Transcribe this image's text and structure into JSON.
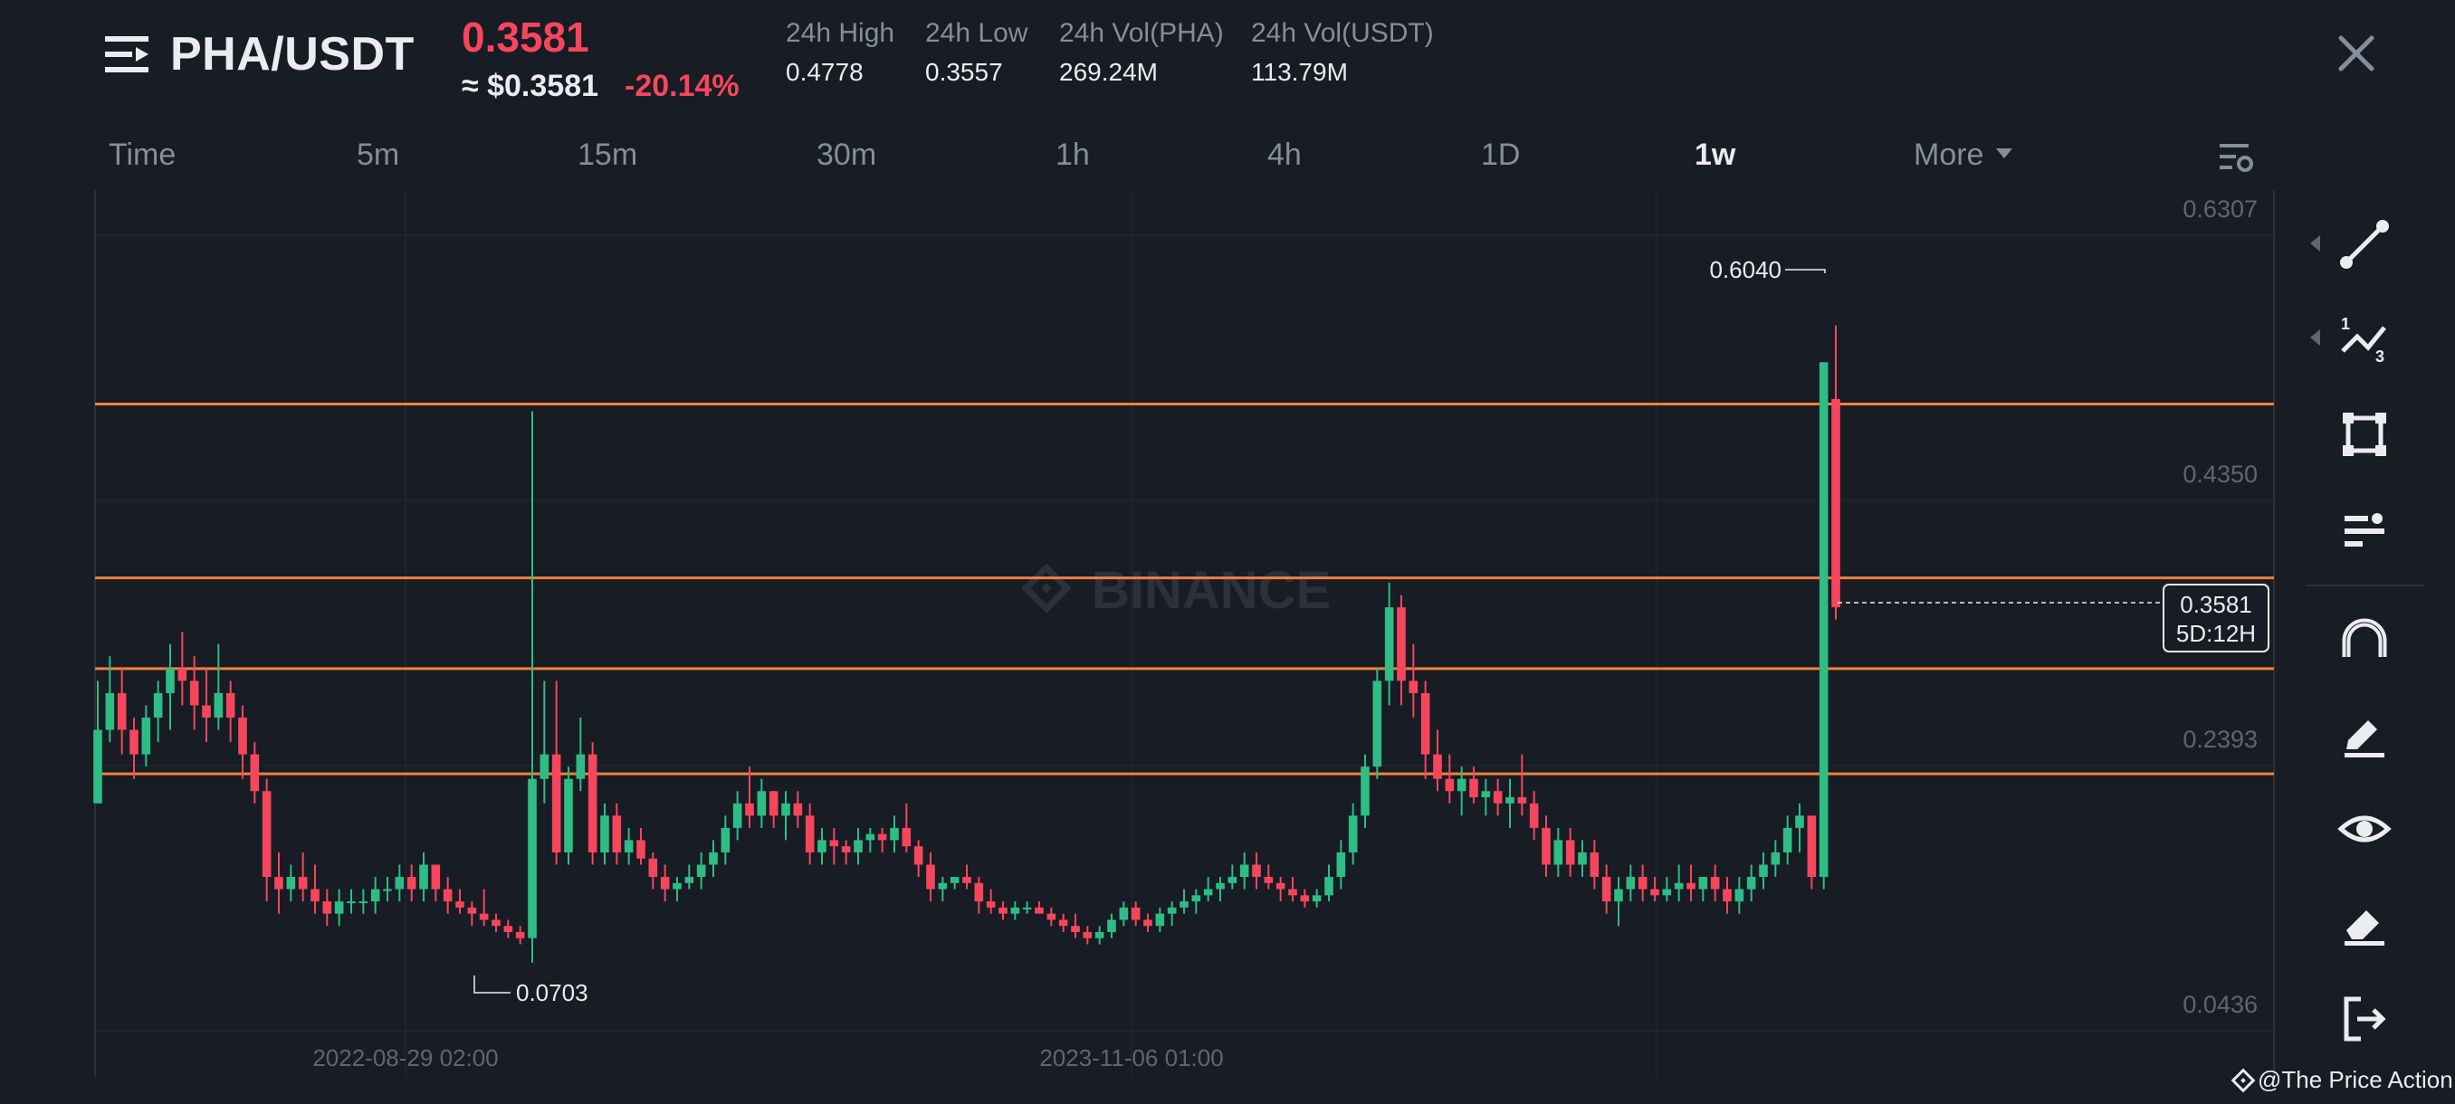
{
  "header": {
    "pair": "PHA/USDT",
    "last_price": "0.3581",
    "usd_price": "≈ $0.3581",
    "change": "-20.14%",
    "stats": [
      {
        "label": "24h High",
        "value": "0.4778"
      },
      {
        "label": "24h Low",
        "value": "0.3557"
      },
      {
        "label": "24h Vol(PHA)",
        "value": "269.24M"
      },
      {
        "label": "24h Vol(USDT)",
        "value": "113.79M"
      }
    ]
  },
  "intervals": [
    {
      "label": "Time",
      "active": false
    },
    {
      "label": "5m",
      "active": false
    },
    {
      "label": "15m",
      "active": false
    },
    {
      "label": "30m",
      "active": false
    },
    {
      "label": "1h",
      "active": false
    },
    {
      "label": "4h",
      "active": false
    },
    {
      "label": "1D",
      "active": false
    },
    {
      "label": "1w",
      "active": true
    },
    {
      "label": "More",
      "active": false
    }
  ],
  "chart_data": {
    "type": "candlestick",
    "interval": "1w",
    "y_axis_labels": [
      "0.6307",
      "0.4350",
      "0.2393",
      "0.0436"
    ],
    "ylim": [
      0.0145,
      0.6636
    ],
    "x_axis_labels": [
      "2022-08-29 02:00",
      "2023-11-06 01:00"
    ],
    "watermark": "BINANCE",
    "high_marker": "0.6040",
    "low_marker": "0.0703",
    "current_price": "0.3581",
    "countdown": "5D:12H",
    "horizontal_levels": [
      0.5259,
      0.384,
      0.31,
      0.2241
    ],
    "level_color": "#f0803c",
    "up_color": "#2ebd85",
    "down_color": "#f6465d",
    "candles": [
      [
        0.2,
        0.3,
        0.23,
        0.26
      ],
      [
        0.26,
        0.32,
        0.25,
        0.29
      ],
      [
        0.29,
        0.31,
        0.24,
        0.26
      ],
      [
        0.26,
        0.27,
        0.22,
        0.24
      ],
      [
        0.24,
        0.28,
        0.23,
        0.27
      ],
      [
        0.27,
        0.3,
        0.25,
        0.29
      ],
      [
        0.29,
        0.33,
        0.26,
        0.31
      ],
      [
        0.31,
        0.34,
        0.28,
        0.3
      ],
      [
        0.3,
        0.32,
        0.26,
        0.28
      ],
      [
        0.28,
        0.31,
        0.25,
        0.27
      ],
      [
        0.27,
        0.33,
        0.26,
        0.29
      ],
      [
        0.29,
        0.3,
        0.25,
        0.27
      ],
      [
        0.27,
        0.28,
        0.22,
        0.24
      ],
      [
        0.24,
        0.25,
        0.2,
        0.21
      ],
      [
        0.21,
        0.22,
        0.12,
        0.14
      ],
      [
        0.14,
        0.16,
        0.11,
        0.13
      ],
      [
        0.13,
        0.15,
        0.12,
        0.14
      ],
      [
        0.14,
        0.16,
        0.12,
        0.13
      ],
      [
        0.13,
        0.15,
        0.11,
        0.12
      ],
      [
        0.12,
        0.13,
        0.1,
        0.11
      ],
      [
        0.11,
        0.13,
        0.1,
        0.12
      ],
      [
        0.12,
        0.13,
        0.11,
        0.12
      ],
      [
        0.12,
        0.13,
        0.11,
        0.12
      ],
      [
        0.12,
        0.14,
        0.11,
        0.13
      ],
      [
        0.13,
        0.14,
        0.12,
        0.13
      ],
      [
        0.13,
        0.15,
        0.12,
        0.14
      ],
      [
        0.14,
        0.15,
        0.12,
        0.13
      ],
      [
        0.13,
        0.16,
        0.12,
        0.15
      ],
      [
        0.15,
        0.15,
        0.12,
        0.13
      ],
      [
        0.13,
        0.14,
        0.11,
        0.12
      ],
      [
        0.12,
        0.13,
        0.11,
        0.115
      ],
      [
        0.115,
        0.12,
        0.1,
        0.11
      ],
      [
        0.11,
        0.13,
        0.1,
        0.105
      ],
      [
        0.105,
        0.11,
        0.095,
        0.1
      ],
      [
        0.1,
        0.105,
        0.09,
        0.095
      ],
      [
        0.095,
        0.1,
        0.085,
        0.09
      ],
      [
        0.09,
        0.52,
        0.07,
        0.22
      ],
      [
        0.22,
        0.3,
        0.2,
        0.24
      ],
      [
        0.24,
        0.3,
        0.15,
        0.16
      ],
      [
        0.16,
        0.23,
        0.15,
        0.22
      ],
      [
        0.22,
        0.27,
        0.21,
        0.24
      ],
      [
        0.24,
        0.25,
        0.15,
        0.16
      ],
      [
        0.16,
        0.2,
        0.15,
        0.19
      ],
      [
        0.19,
        0.2,
        0.15,
        0.16
      ],
      [
        0.16,
        0.18,
        0.15,
        0.17
      ],
      [
        0.17,
        0.18,
        0.15,
        0.155
      ],
      [
        0.155,
        0.16,
        0.13,
        0.14
      ],
      [
        0.14,
        0.15,
        0.12,
        0.13
      ],
      [
        0.13,
        0.14,
        0.12,
        0.135
      ],
      [
        0.135,
        0.15,
        0.13,
        0.14
      ],
      [
        0.14,
        0.16,
        0.13,
        0.15
      ],
      [
        0.15,
        0.17,
        0.14,
        0.16
      ],
      [
        0.16,
        0.19,
        0.15,
        0.18
      ],
      [
        0.18,
        0.21,
        0.17,
        0.2
      ],
      [
        0.2,
        0.23,
        0.18,
        0.19
      ],
      [
        0.19,
        0.22,
        0.18,
        0.21
      ],
      [
        0.21,
        0.21,
        0.18,
        0.19
      ],
      [
        0.19,
        0.21,
        0.17,
        0.2
      ],
      [
        0.2,
        0.21,
        0.18,
        0.19
      ],
      [
        0.19,
        0.2,
        0.15,
        0.16
      ],
      [
        0.16,
        0.18,
        0.15,
        0.17
      ],
      [
        0.17,
        0.18,
        0.15,
        0.165
      ],
      [
        0.165,
        0.17,
        0.15,
        0.16
      ],
      [
        0.16,
        0.18,
        0.15,
        0.17
      ],
      [
        0.17,
        0.18,
        0.16,
        0.175
      ],
      [
        0.175,
        0.18,
        0.16,
        0.17
      ],
      [
        0.17,
        0.19,
        0.16,
        0.18
      ],
      [
        0.18,
        0.2,
        0.16,
        0.165
      ],
      [
        0.165,
        0.17,
        0.14,
        0.15
      ],
      [
        0.15,
        0.16,
        0.12,
        0.13
      ],
      [
        0.13,
        0.14,
        0.12,
        0.135
      ],
      [
        0.135,
        0.14,
        0.13,
        0.14
      ],
      [
        0.14,
        0.15,
        0.13,
        0.135
      ],
      [
        0.135,
        0.14,
        0.11,
        0.12
      ],
      [
        0.12,
        0.13,
        0.11,
        0.115
      ],
      [
        0.115,
        0.12,
        0.105,
        0.11
      ],
      [
        0.11,
        0.12,
        0.105,
        0.115
      ],
      [
        0.115,
        0.12,
        0.11,
        0.115
      ],
      [
        0.115,
        0.12,
        0.11,
        0.11
      ],
      [
        0.11,
        0.115,
        0.1,
        0.105
      ],
      [
        0.105,
        0.11,
        0.095,
        0.1
      ],
      [
        0.1,
        0.11,
        0.09,
        0.095
      ],
      [
        0.095,
        0.1,
        0.085,
        0.09
      ],
      [
        0.09,
        0.1,
        0.085,
        0.095
      ],
      [
        0.095,
        0.11,
        0.09,
        0.105
      ],
      [
        0.105,
        0.12,
        0.1,
        0.115
      ],
      [
        0.115,
        0.12,
        0.1,
        0.105
      ],
      [
        0.105,
        0.11,
        0.095,
        0.1
      ],
      [
        0.1,
        0.115,
        0.095,
        0.11
      ],
      [
        0.11,
        0.12,
        0.1,
        0.115
      ],
      [
        0.115,
        0.13,
        0.11,
        0.12
      ],
      [
        0.12,
        0.13,
        0.11,
        0.125
      ],
      [
        0.125,
        0.14,
        0.12,
        0.13
      ],
      [
        0.13,
        0.14,
        0.12,
        0.135
      ],
      [
        0.135,
        0.15,
        0.13,
        0.14
      ],
      [
        0.14,
        0.16,
        0.13,
        0.15
      ],
      [
        0.15,
        0.16,
        0.13,
        0.14
      ],
      [
        0.14,
        0.15,
        0.13,
        0.135
      ],
      [
        0.135,
        0.14,
        0.12,
        0.13
      ],
      [
        0.13,
        0.14,
        0.12,
        0.125
      ],
      [
        0.125,
        0.13,
        0.115,
        0.12
      ],
      [
        0.12,
        0.13,
        0.115,
        0.125
      ],
      [
        0.125,
        0.15,
        0.12,
        0.14
      ],
      [
        0.14,
        0.17,
        0.13,
        0.16
      ],
      [
        0.16,
        0.2,
        0.15,
        0.19
      ],
      [
        0.19,
        0.24,
        0.18,
        0.23
      ],
      [
        0.23,
        0.31,
        0.22,
        0.3
      ],
      [
        0.3,
        0.38,
        0.28,
        0.36
      ],
      [
        0.36,
        0.37,
        0.28,
        0.3
      ],
      [
        0.3,
        0.33,
        0.27,
        0.29
      ],
      [
        0.29,
        0.3,
        0.22,
        0.24
      ],
      [
        0.24,
        0.26,
        0.21,
        0.22
      ],
      [
        0.22,
        0.24,
        0.2,
        0.21
      ],
      [
        0.21,
        0.23,
        0.19,
        0.22
      ],
      [
        0.22,
        0.23,
        0.2,
        0.205
      ],
      [
        0.205,
        0.22,
        0.19,
        0.21
      ],
      [
        0.21,
        0.22,
        0.19,
        0.2
      ],
      [
        0.2,
        0.22,
        0.18,
        0.205
      ],
      [
        0.205,
        0.24,
        0.19,
        0.2
      ],
      [
        0.2,
        0.21,
        0.17,
        0.18
      ],
      [
        0.18,
        0.19,
        0.14,
        0.15
      ],
      [
        0.15,
        0.18,
        0.14,
        0.17
      ],
      [
        0.17,
        0.18,
        0.14,
        0.15
      ],
      [
        0.15,
        0.17,
        0.14,
        0.16
      ],
      [
        0.16,
        0.17,
        0.13,
        0.14
      ],
      [
        0.14,
        0.15,
        0.11,
        0.12
      ],
      [
        0.12,
        0.14,
        0.1,
        0.13
      ],
      [
        0.13,
        0.15,
        0.12,
        0.14
      ],
      [
        0.14,
        0.15,
        0.12,
        0.13
      ],
      [
        0.13,
        0.14,
        0.12,
        0.125
      ],
      [
        0.125,
        0.14,
        0.12,
        0.13
      ],
      [
        0.13,
        0.15,
        0.12,
        0.135
      ],
      [
        0.135,
        0.15,
        0.12,
        0.13
      ],
      [
        0.13,
        0.14,
        0.12,
        0.14
      ],
      [
        0.14,
        0.15,
        0.12,
        0.13
      ],
      [
        0.13,
        0.14,
        0.11,
        0.12
      ],
      [
        0.12,
        0.14,
        0.11,
        0.13
      ],
      [
        0.13,
        0.15,
        0.12,
        0.14
      ],
      [
        0.14,
        0.16,
        0.13,
        0.15
      ],
      [
        0.15,
        0.17,
        0.14,
        0.16
      ],
      [
        0.16,
        0.19,
        0.15,
        0.18
      ],
      [
        0.18,
        0.2,
        0.16,
        0.19
      ],
      [
        0.19,
        0.17,
        0.13,
        0.14
      ],
      [
        0.14,
        0.35,
        0.13,
        0.56
      ],
      [
        0.53,
        0.59,
        0.35,
        0.36
      ]
    ]
  },
  "toolbar": {
    "tools": [
      "trend-line-icon",
      "fibonacci-icon",
      "rectangle-icon",
      "text-lines-icon",
      "magnet-icon",
      "brush-icon",
      "eye-icon",
      "eraser-icon",
      "exit-icon"
    ]
  },
  "watermark_credit": "@The Price Action"
}
